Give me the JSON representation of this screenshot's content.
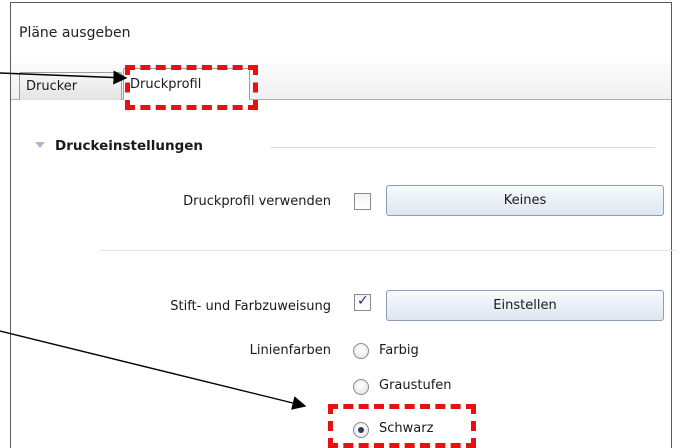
{
  "window": {
    "title": "Pläne ausgeben"
  },
  "tabs": [
    {
      "label": "Drucker",
      "active": false
    },
    {
      "label": "Druckprofil",
      "active": true
    }
  ],
  "section": {
    "title": "Druckeinstellungen"
  },
  "settings": {
    "use_profile": {
      "label": "Druckprofil verwenden",
      "checked": false,
      "button": "Keines"
    },
    "pen_color": {
      "label": "Stift- und Farbzuweisung",
      "checked": true,
      "button": "Einstellen"
    },
    "line_colors": {
      "label": "Linienfarben",
      "options": [
        {
          "label": "Farbig",
          "selected": false
        },
        {
          "label": "Graustufen",
          "selected": false
        },
        {
          "label": "Schwarz",
          "selected": true
        }
      ]
    }
  },
  "colors": {
    "highlight": "#e81010",
    "arrow": "#000000"
  }
}
